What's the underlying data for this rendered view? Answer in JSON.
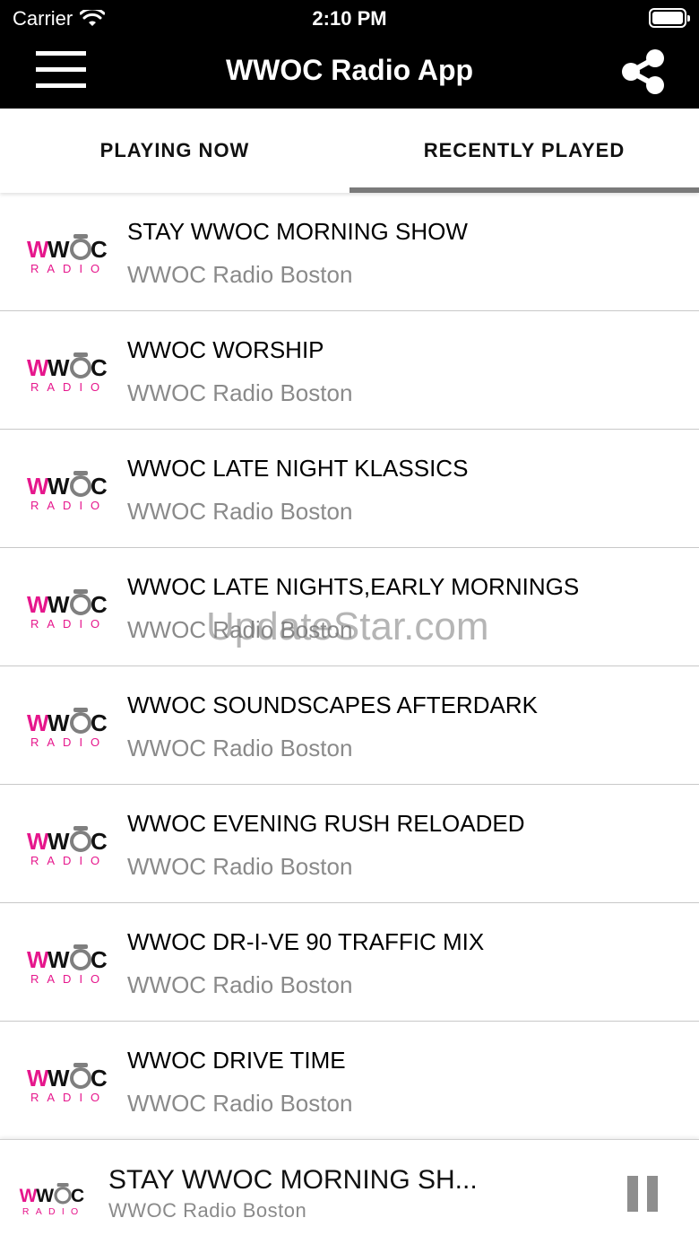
{
  "status_bar": {
    "carrier": "Carrier",
    "time": "2:10 PM"
  },
  "nav": {
    "title": "WWOC Radio App",
    "menu_icon": "hamburger-menu-icon",
    "share_icon": "share-icon"
  },
  "tabs": [
    {
      "label": "PLAYING NOW",
      "active": false
    },
    {
      "label": "RECENTLY PLAYED",
      "active": true
    }
  ],
  "logo": {
    "brand": "WWOC",
    "sub": "RADIO",
    "brand_color": "#e6168c",
    "ring_color": "#7f7f7f"
  },
  "list": [
    {
      "title": "STAY WWOC MORNING SHOW",
      "subtitle": "WWOC Radio Boston"
    },
    {
      "title": "WWOC WORSHIP",
      "subtitle": "WWOC Radio Boston"
    },
    {
      "title": "WWOC LATE NIGHT KLASSICS",
      "subtitle": "WWOC Radio Boston"
    },
    {
      "title": "WWOC LATE NIGHTS,EARLY MORNINGS",
      "subtitle": "WWOC Radio Boston"
    },
    {
      "title": "WWOC SOUNDSCAPES AFTERDARK",
      "subtitle": "WWOC Radio Boston"
    },
    {
      "title": "WWOC EVENING RUSH RELOADED",
      "subtitle": "WWOC Radio Boston"
    },
    {
      "title": "WWOC DR-I-VE 90 TRAFFIC MIX",
      "subtitle": "WWOC Radio Boston"
    },
    {
      "title": "WWOC DRIVE TIME",
      "subtitle": "WWOC Radio Boston"
    }
  ],
  "watermark": "UpdateStar.com",
  "player": {
    "title": "STAY WWOC MORNING SH...",
    "subtitle": "WWOC Radio Boston",
    "pause_icon": "pause-icon"
  }
}
